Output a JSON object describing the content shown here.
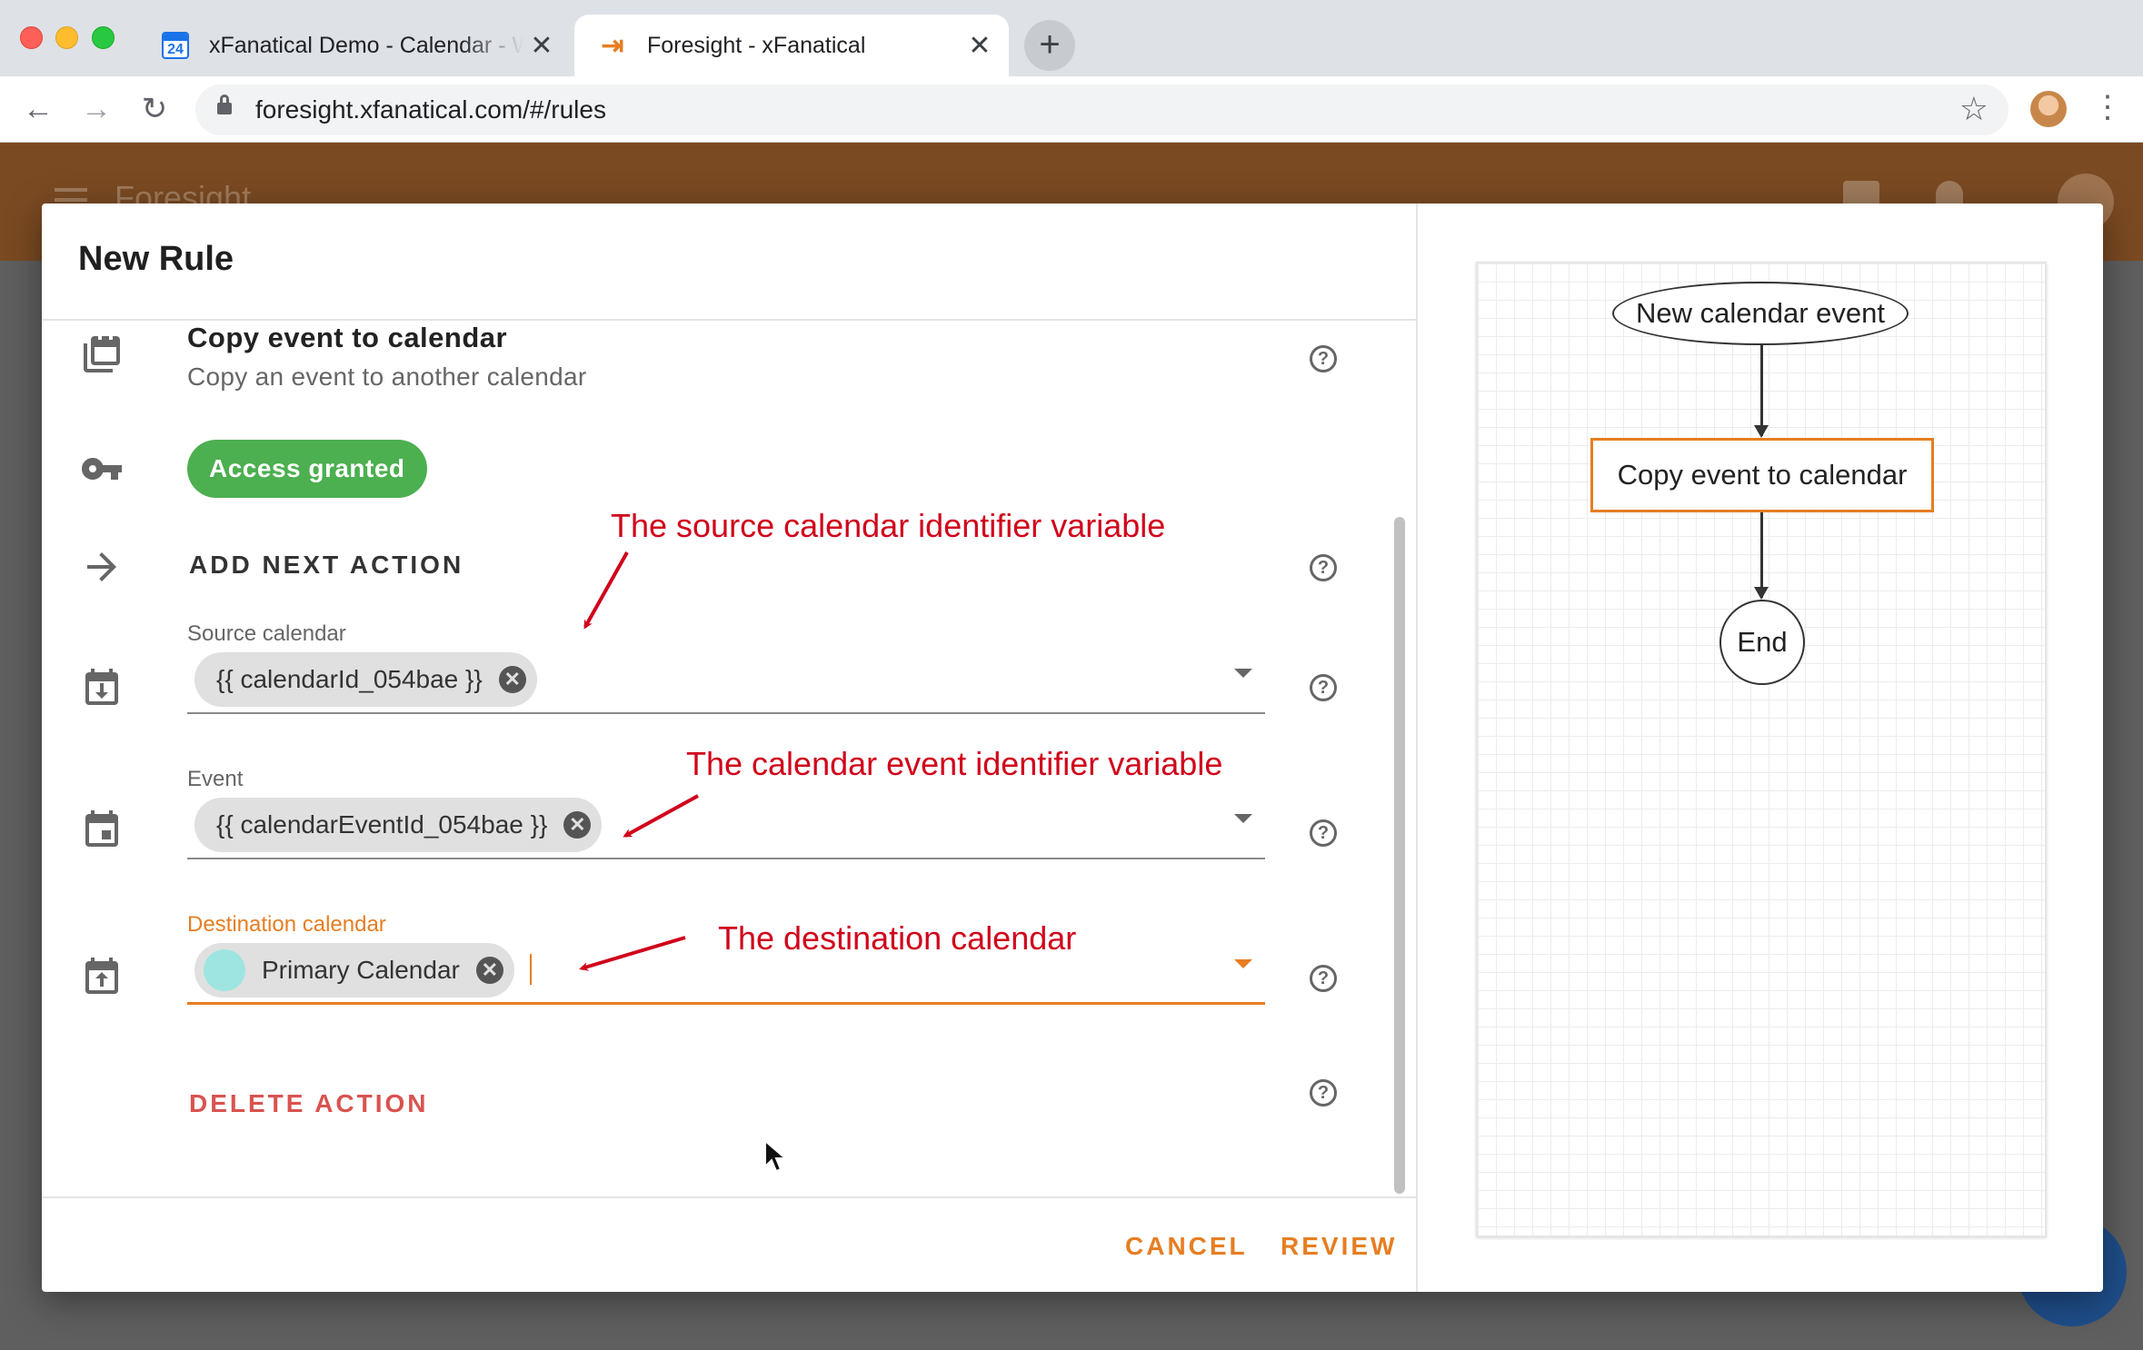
{
  "browser": {
    "tabs": [
      {
        "title": "xFanatical Demo - Calendar - W",
        "favicon_text": "24",
        "close": "✕"
      },
      {
        "title": "Foresight - xFanatical",
        "favicon_text": "⇥",
        "close": "✕"
      }
    ],
    "new_tab": "+",
    "url": "foresight.xfanatical.com/#/rules",
    "star": "☆",
    "menu": "⋮",
    "nav": {
      "back": "←",
      "forward": "→",
      "reload": "↻"
    }
  },
  "app": {
    "title": "Foresight"
  },
  "dialog": {
    "title": "New Rule",
    "action": {
      "title": "Copy event to calendar",
      "description": "Copy an event to another calendar"
    },
    "access_badge": "Access granted",
    "add_next_action": "ADD NEXT ACTION",
    "fields": {
      "source": {
        "label": "Source calendar",
        "chip": "{{ calendarId_054bae }}"
      },
      "event": {
        "label": "Event",
        "chip": "{{ calendarEventId_054bae }}"
      },
      "destination": {
        "label": "Destination calendar",
        "chip": "Primary Calendar",
        "chip_color": "#9ee5e2"
      }
    },
    "delete_action": "DELETE ACTION",
    "help": "?",
    "chip_remove": "✕",
    "buttons": {
      "cancel": "CANCEL",
      "review": "REVIEW"
    },
    "accent_color": "#e67e22"
  },
  "annotations": {
    "source": "The source calendar identifier variable",
    "event": "The calendar event identifier variable",
    "destination": "The destination calendar"
  },
  "flow": {
    "start": "New calendar event",
    "action": "Copy event to calendar",
    "end": "End"
  }
}
